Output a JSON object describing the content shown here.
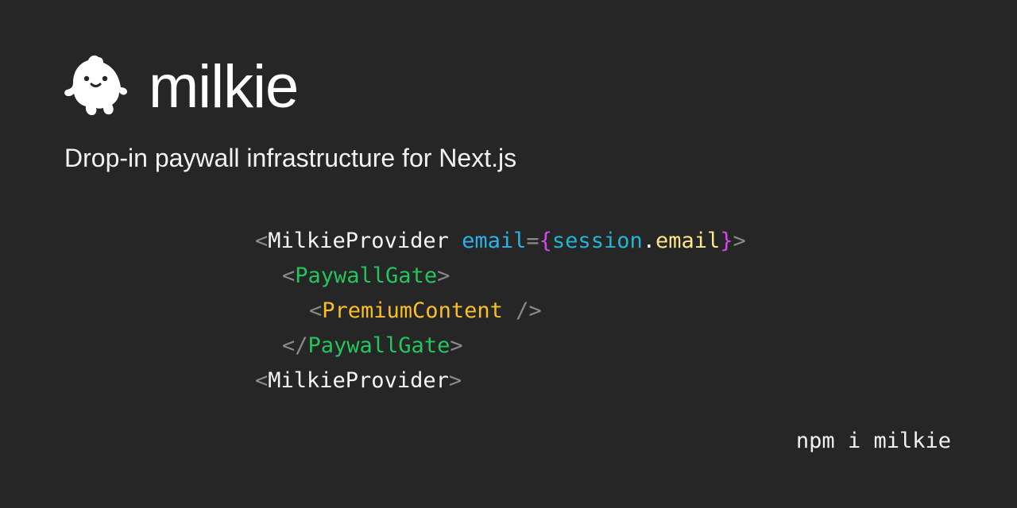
{
  "brand": {
    "name": "milkie",
    "logo_icon": "ghost-mascot-icon"
  },
  "tagline": "Drop-in paywall infrastructure for Next.js",
  "code": {
    "lt": "<",
    "gt": ">",
    "close_open": "</",
    "self_close": " />",
    "line1": {
      "tag": "MilkieProvider",
      "space": " ",
      "attr": "email",
      "equals": "=",
      "lbrace": "{",
      "obj": "session",
      "dot": ".",
      "prop": "email",
      "rbrace": "}"
    },
    "line2_tag": "PaywallGate",
    "line3_tag": "PremiumContent",
    "line4_tag": "PaywallGate",
    "line5_tag": "MilkieProvider"
  },
  "install_command": "npm i milkie",
  "colors": {
    "background": "#262626",
    "punctuation": "#8a8a8a",
    "attribute": "#2bb3e8",
    "brace": "#d946ef",
    "variable": "#22b5d3",
    "property": "#fde68a",
    "component_green": "#22c55e",
    "component_orange": "#fbbf24"
  }
}
